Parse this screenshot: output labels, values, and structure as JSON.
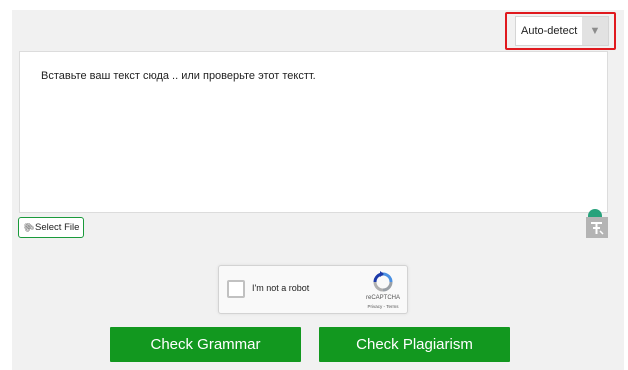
{
  "language_selector": {
    "value": "Auto-detect",
    "arrow_icon": "triangle-down-icon",
    "highlight_color": "#e0191e"
  },
  "editor": {
    "text": "Вставьте ваш текст сюда .. или проверьте этот текстт."
  },
  "select_file": {
    "label": "Select File",
    "icon": "paperclip-icon"
  },
  "captcha": {
    "label": "I'm not a robot",
    "brand": "reCAPTCHA",
    "links": "Privacy - Terms"
  },
  "actions": {
    "check_grammar_label": "Check Grammar",
    "check_plagiarism_label": "Check Plagiarism",
    "button_color": "#12981f"
  }
}
